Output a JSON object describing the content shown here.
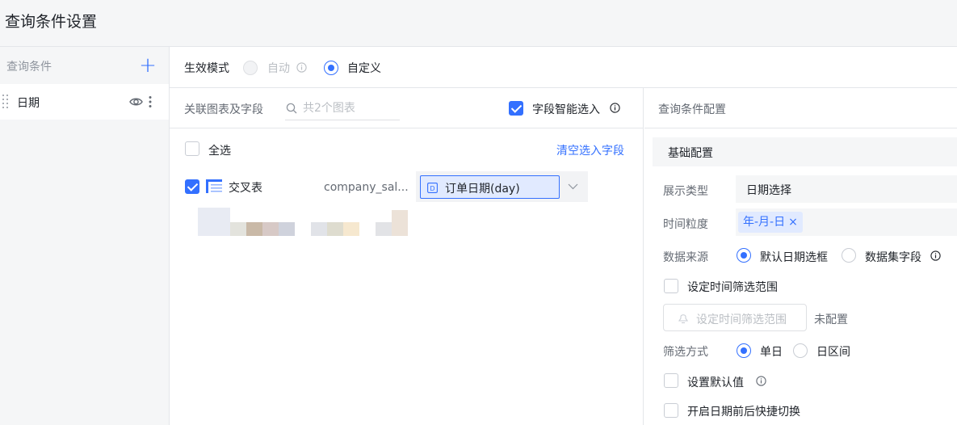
{
  "header": {
    "title": "查询条件设置"
  },
  "sidebar": {
    "title": "查询条件",
    "add_label": "+",
    "items": [
      {
        "label": "日期"
      }
    ]
  },
  "mode": {
    "label": "生效模式",
    "options": [
      {
        "label": "自动",
        "checked": false,
        "disabled": true
      },
      {
        "label": "自定义",
        "checked": true,
        "disabled": false
      }
    ]
  },
  "link_panel": {
    "label": "关联图表及字段",
    "search_placeholder": "共2个图表",
    "smart_label": "字段智能选入",
    "smart_checked": true,
    "select_all": "全选",
    "clear_link": "清空选入字段",
    "charts": [
      {
        "type": "交叉表",
        "dataset": "company_sal...",
        "field": "订单日期(day)",
        "checked": true
      }
    ]
  },
  "config": {
    "title": "查询条件配置",
    "section": "基础配置",
    "display_type": {
      "label": "展示类型",
      "value": "日期选择"
    },
    "granularity": {
      "label": "时间粒度",
      "tag": "年-月-日",
      "remove": "×"
    },
    "data_source": {
      "label": "数据来源",
      "options": [
        {
          "label": "默认日期选框",
          "checked": true
        },
        {
          "label": "数据集字段",
          "checked": false
        }
      ]
    },
    "range": {
      "label": "设定时间筛选范围",
      "button": "设定时间筛选范围",
      "status": "未配置",
      "checked": false
    },
    "filter_mode": {
      "label": "筛选方式",
      "options": [
        {
          "label": "单日",
          "checked": true
        },
        {
          "label": "日区间",
          "checked": false
        }
      ]
    },
    "default_value": {
      "label": "设置默认值",
      "checked": false
    },
    "quick_switch": {
      "label": "开启日期前后快捷切换",
      "checked": false
    }
  },
  "colors": {
    "accent": "#3370ff",
    "tag_bg": "#e1eaff",
    "panel_bg": "#f5f6f7"
  }
}
